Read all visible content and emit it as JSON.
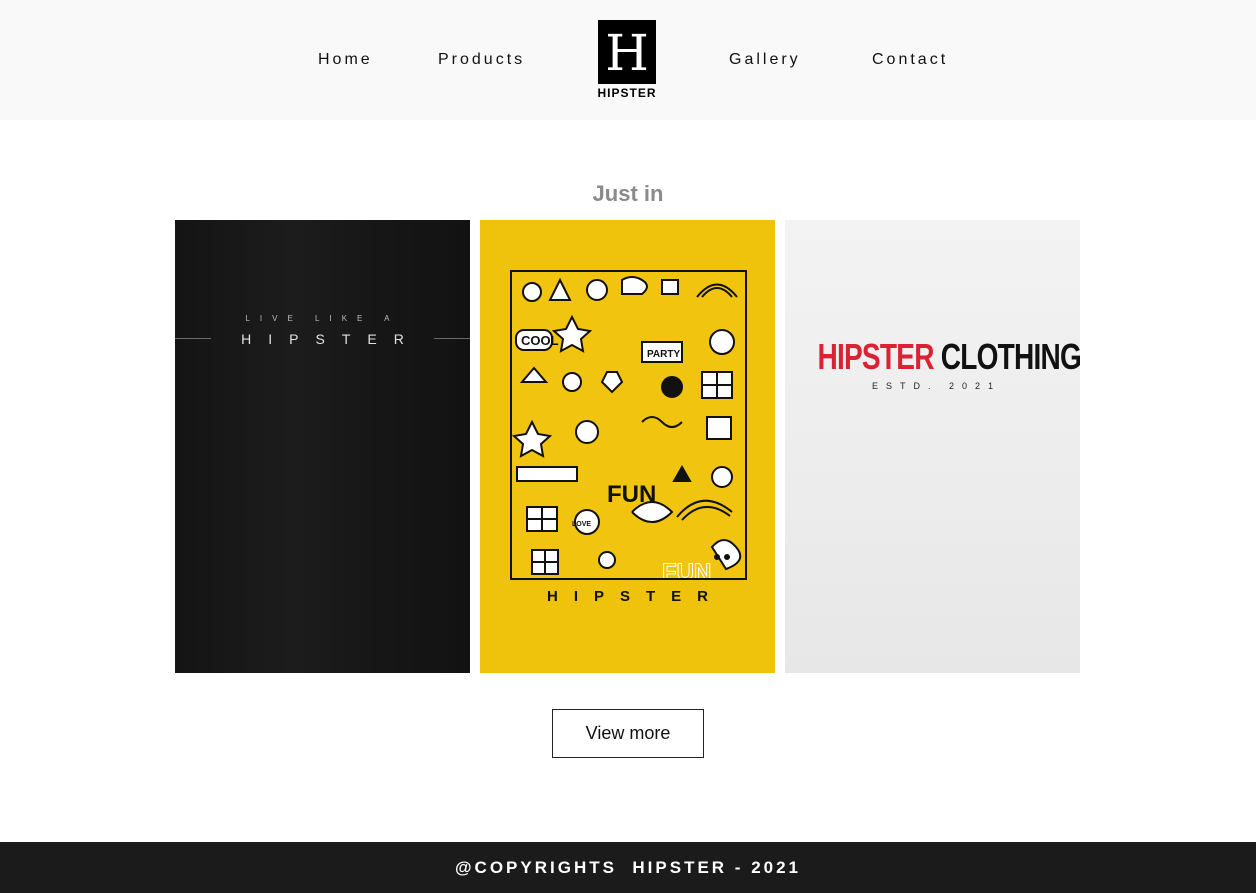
{
  "nav": {
    "items": [
      {
        "label": "Home"
      },
      {
        "label": "Products"
      },
      {
        "label": "Gallery"
      },
      {
        "label": "Contact"
      }
    ],
    "logo": {
      "letter": "H",
      "text": "HIPSTER"
    }
  },
  "section": {
    "title": "Just in"
  },
  "products": [
    {
      "name": "black-tee",
      "background": "#141414",
      "print_small": "LIVE LIKE A",
      "print_large": "HIPSTER"
    },
    {
      "name": "yellow-tee",
      "background": "#efc20b",
      "doodles": [
        "COOL",
        "PARTY",
        "FUN",
        "LOVE",
        "FUN"
      ],
      "print_large": "HIPSTER"
    },
    {
      "name": "white-tee",
      "background": "#efefef",
      "print_red": "HIPSTER",
      "print_dark": "CLOTHING",
      "print_sub": "ESTD. 2021",
      "accent": "#d92232"
    }
  ],
  "actions": {
    "view_more": "View more"
  },
  "footer": {
    "text": "@COPYRIGHTS  HIPSTER - 2021"
  }
}
